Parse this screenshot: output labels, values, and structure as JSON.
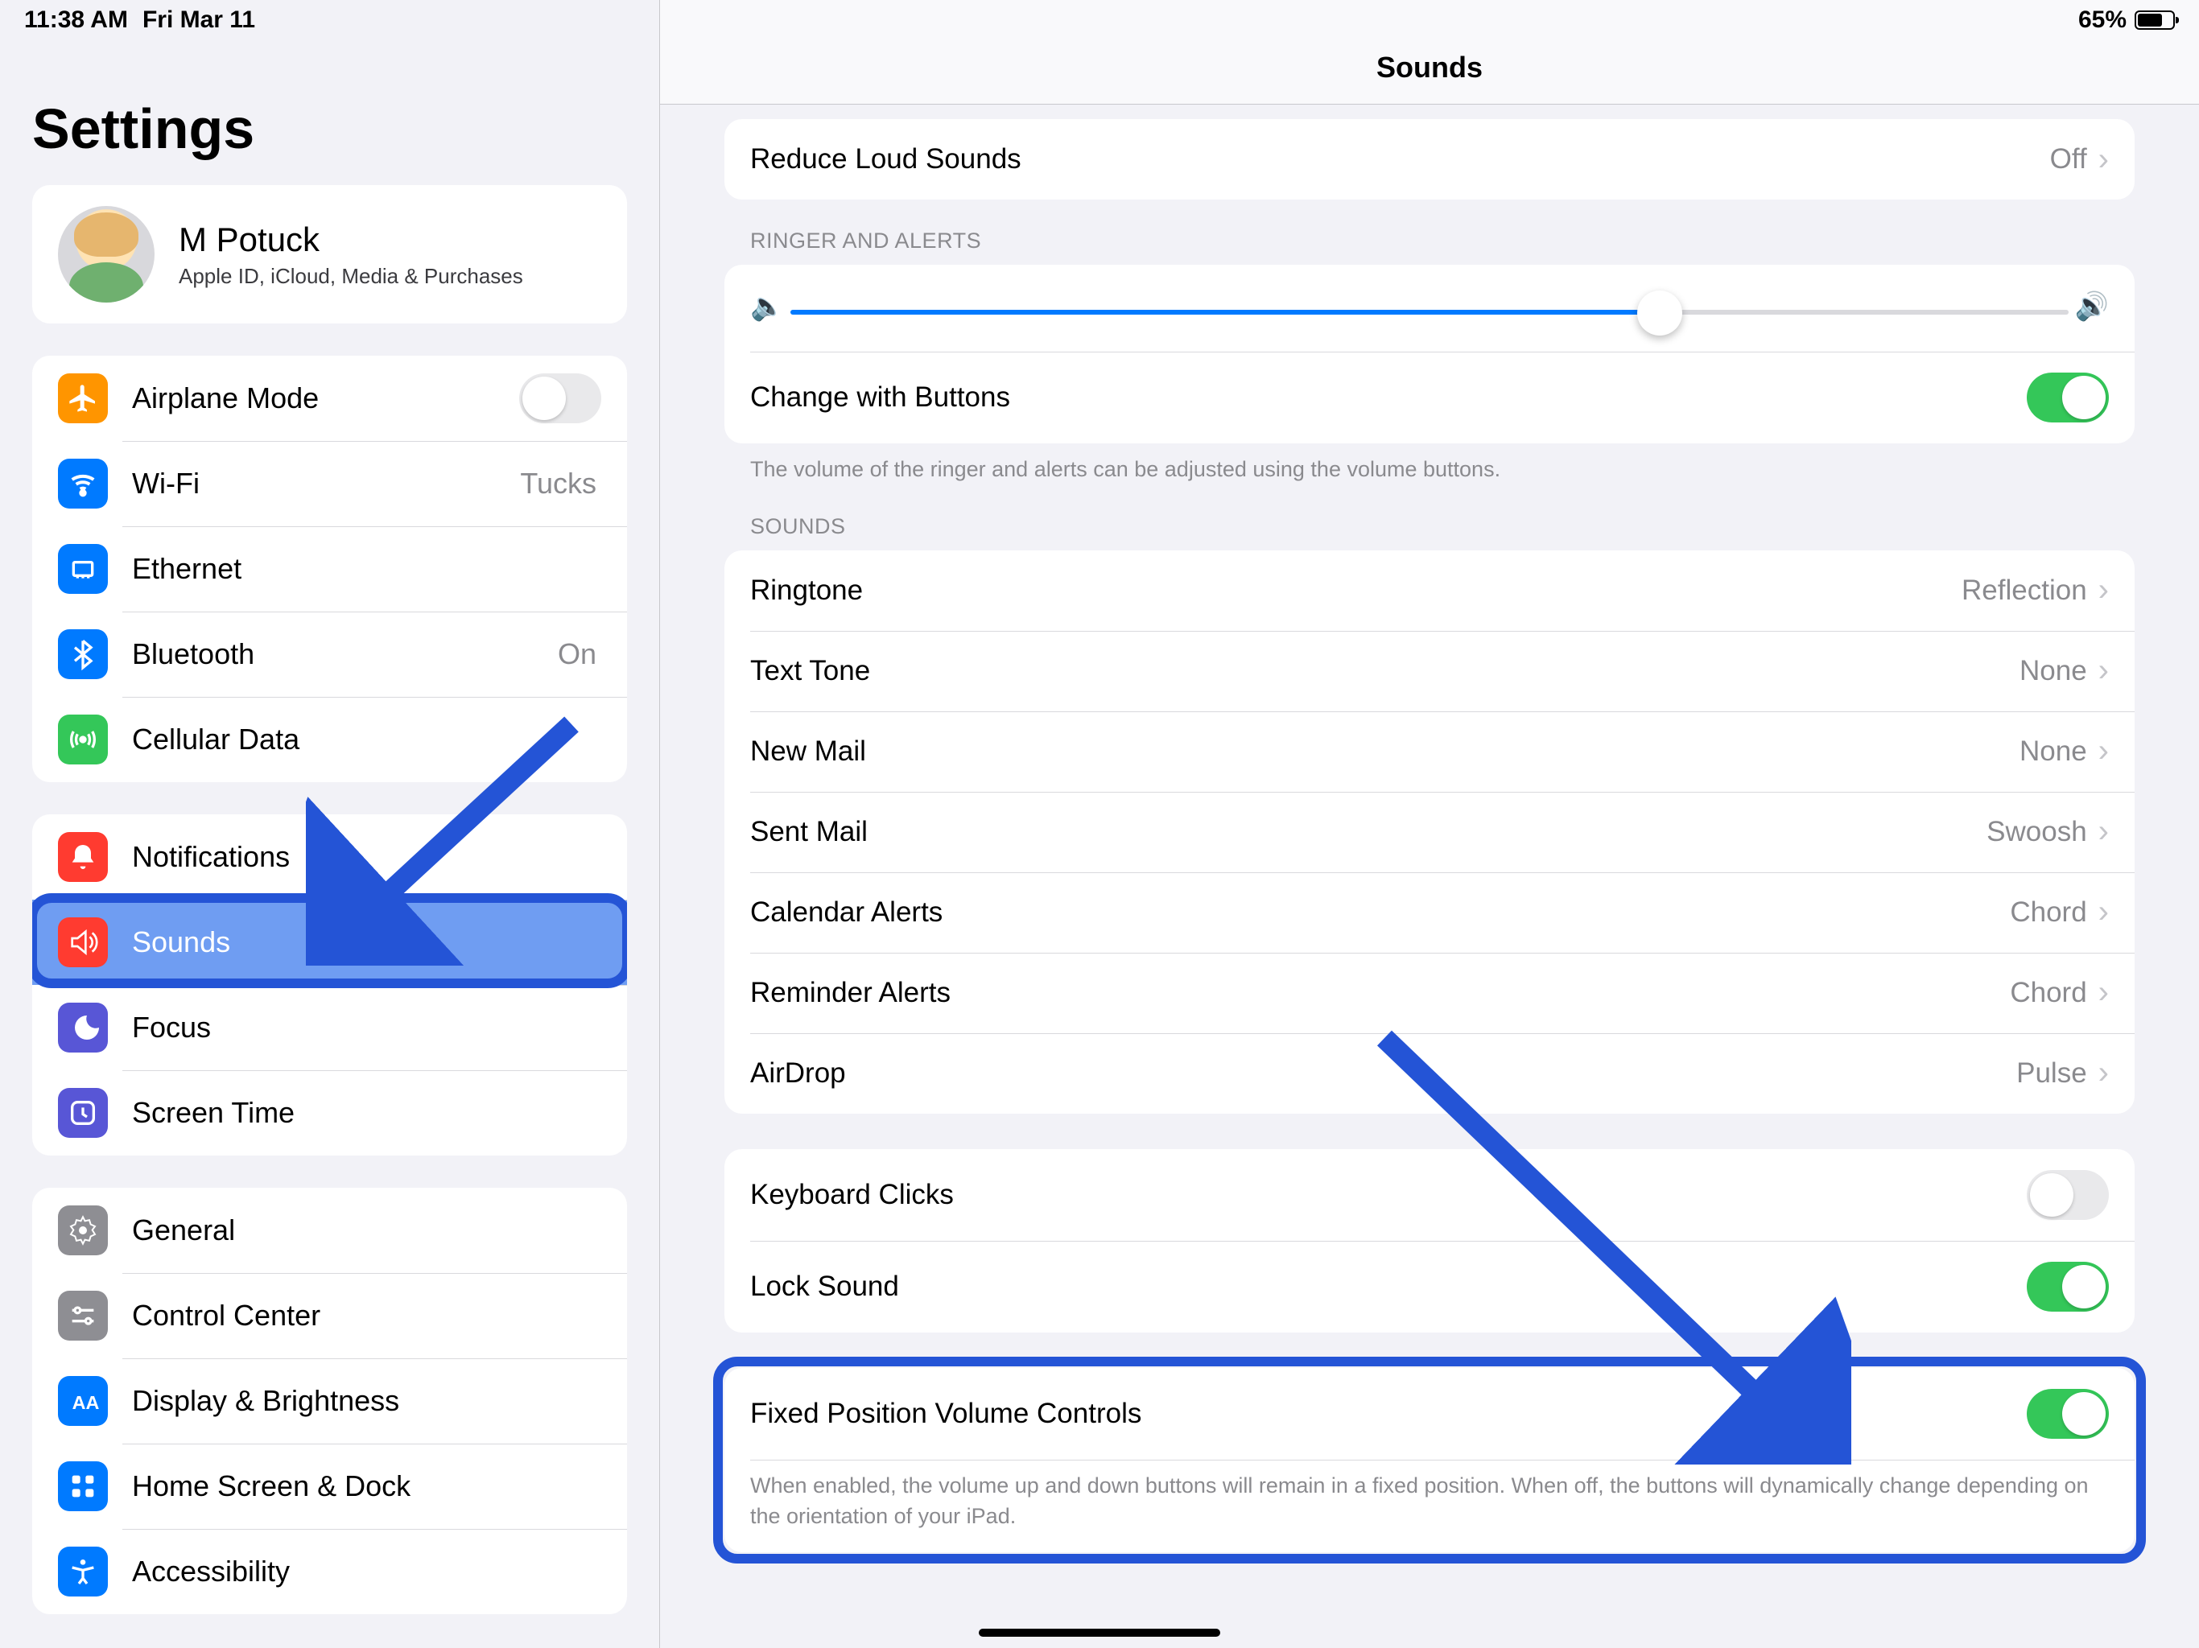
{
  "status": {
    "time": "11:38 AM",
    "date": "Fri Mar 11",
    "battery_pct": "65%"
  },
  "sidebar": {
    "title": "Settings",
    "account": {
      "name": "M Potuck",
      "subtitle": "Apple ID, iCloud, Media & Purchases"
    },
    "group1": {
      "items": [
        {
          "label": "Airplane Mode",
          "value": ""
        },
        {
          "label": "Wi-Fi",
          "value": "Tucks"
        },
        {
          "label": "Ethernet",
          "value": ""
        },
        {
          "label": "Bluetooth",
          "value": "On"
        },
        {
          "label": "Cellular Data",
          "value": ""
        }
      ]
    },
    "group2": {
      "items": [
        {
          "label": "Notifications"
        },
        {
          "label": "Sounds"
        },
        {
          "label": "Focus"
        },
        {
          "label": "Screen Time"
        }
      ]
    },
    "group3": {
      "items": [
        {
          "label": "General"
        },
        {
          "label": "Control Center"
        },
        {
          "label": "Display & Brightness"
        },
        {
          "label": "Home Screen & Dock"
        },
        {
          "label": "Accessibility"
        }
      ]
    }
  },
  "detail": {
    "title": "Sounds",
    "headphone": {
      "reduce_loud": "Reduce Loud Sounds",
      "reduce_loud_value": "Off"
    },
    "ringer_header": "RINGER AND ALERTS",
    "change_with_buttons": "Change with Buttons",
    "ringer_footer": "The volume of the ringer and alerts can be adjusted using the volume buttons.",
    "sounds_header": "SOUNDS",
    "sounds": [
      {
        "label": "Ringtone",
        "value": "Reflection"
      },
      {
        "label": "Text Tone",
        "value": "None"
      },
      {
        "label": "New Mail",
        "value": "None"
      },
      {
        "label": "Sent Mail",
        "value": "Swoosh"
      },
      {
        "label": "Calendar Alerts",
        "value": "Chord"
      },
      {
        "label": "Reminder Alerts",
        "value": "Chord"
      },
      {
        "label": "AirDrop",
        "value": "Pulse"
      }
    ],
    "keyboard_clicks": "Keyboard Clicks",
    "lock_sound": "Lock Sound",
    "fixed_pos": "Fixed Position Volume Controls",
    "fixed_pos_footer": "When enabled, the volume up and down buttons will remain in a fixed position. When off, the buttons will dynamically change depending on the orientation of your iPad."
  },
  "colors": {
    "accent": "#2454d6"
  }
}
